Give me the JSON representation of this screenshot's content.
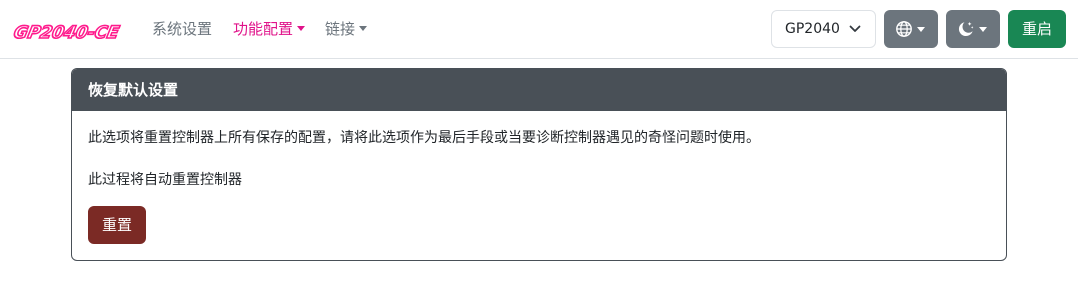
{
  "brand": {
    "logo_text": "GP2040-CE",
    "logo_color": "#ff1a8c"
  },
  "nav": {
    "items": [
      {
        "label": "系统设置",
        "has_dropdown": false,
        "active": false
      },
      {
        "label": "功能配置",
        "has_dropdown": true,
        "active": true
      },
      {
        "label": "链接",
        "has_dropdown": true,
        "active": false
      }
    ]
  },
  "toolbar": {
    "board_select_value": "GP2040",
    "language_icon": "globe-icon",
    "theme_icon": "moon-stars-icon",
    "restart_label": "重启"
  },
  "card": {
    "header": "恢复默认设置",
    "description": "此选项将重置控制器上所有保存的配置，请将此选项作为最后手段或当要诊断控制器遇见的奇怪问题时使用。",
    "note": "此过程将自动重置控制器",
    "reset_label": "重置"
  },
  "colors": {
    "accent": "#e0138a",
    "success": "#198754",
    "secondary": "#6c757d",
    "card_header": "#495057",
    "danger_dark": "#7b2a25"
  }
}
